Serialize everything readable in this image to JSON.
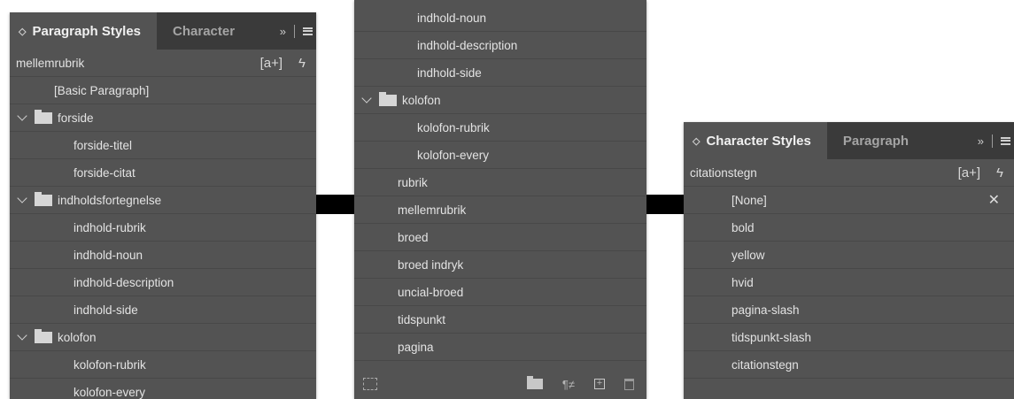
{
  "paragraph_panel": {
    "tab_active": "Paragraph Styles",
    "tab_inactive": "Character",
    "expand_glyph": "»",
    "current_style": "mellemrubrik",
    "new_from_selection": "[a+]",
    "quick_apply": "ϟ",
    "items": {
      "basic": "[Basic Paragraph]",
      "forside": "forside",
      "forside_titel": "forside-titel",
      "forside_citat": "forside-citat",
      "indholdsfortegnelse": "indholdsfortegnelse",
      "indhold_rubrik": "indhold-rubrik",
      "indhold_noun": "indhold-noun",
      "indhold_description": "indhold-description",
      "indhold_side": "indhold-side",
      "kolofon": "kolofon",
      "kolofon_rubrik": "kolofon-rubrik",
      "kolofon_every_partial": "kolofon-every"
    }
  },
  "paragraph_panel_scrolled": {
    "items": {
      "indhold_noun": "indhold-noun",
      "indhold_description": "indhold-description",
      "indhold_side": "indhold-side",
      "kolofon": "kolofon",
      "kolofon_rubrik": "kolofon-rubrik",
      "kolofon_every": "kolofon-every",
      "rubrik": "rubrik",
      "mellemrubrik": "mellemrubrik",
      "broed": "broed",
      "broed_indryk": "broed indryk",
      "uncial_broed": "uncial-broed",
      "tidspunkt": "tidspunkt",
      "pagina": "pagina"
    },
    "bottom_icons": [
      "load-styles-icon",
      "new-group-icon",
      "clear-overrides-icon",
      "new-style-icon",
      "delete-icon"
    ],
    "clear_overrides_glyph": "¶≠"
  },
  "character_panel": {
    "tab_active": "Character Styles",
    "tab_inactive": "Paragraph",
    "expand_glyph": "»",
    "current_style": "citationstegn",
    "new_from_selection": "[a+]",
    "quick_apply": "ϟ",
    "none_icon": "✕",
    "items": {
      "none": "[None]",
      "bold": "bold",
      "yellow": "yellow",
      "hvid": "hvid",
      "pagina_slash": "pagina-slash",
      "tidspunkt_slash": "tidspunkt-slash",
      "citationstegn": "citationstegn"
    }
  },
  "colors": {
    "panel": "#535353",
    "tabbar": "#3a3a3a",
    "connector": "#000000"
  }
}
